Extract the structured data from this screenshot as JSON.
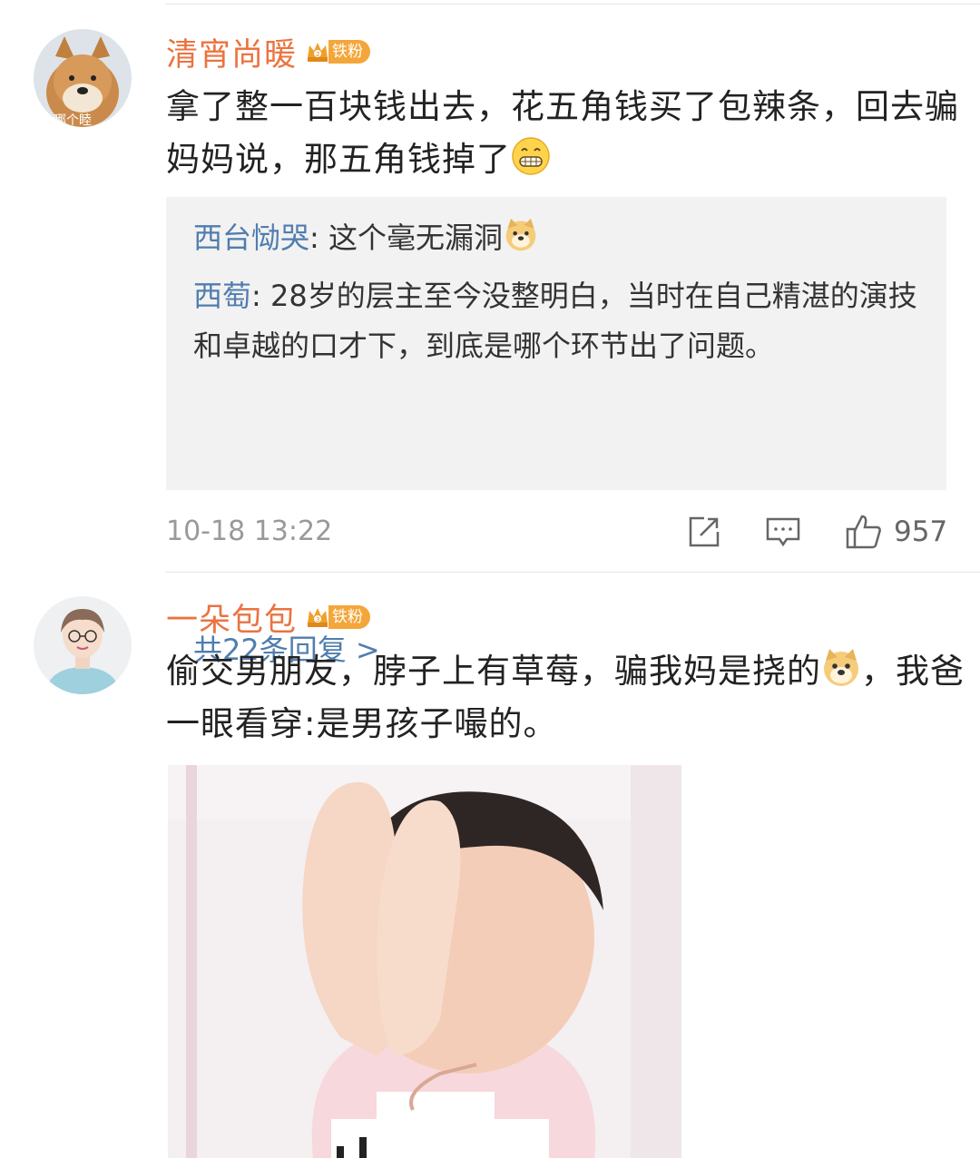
{
  "comments": [
    {
      "username": "清宵尚暖",
      "badge": "铁粉",
      "avatar_caption": "哪个睦",
      "text": "拿了整一百块钱出去，花五角钱买了包辣条，回去骗妈妈说，那五角钱掉了",
      "emoji": "grin-emoji",
      "replies": [
        {
          "name": "西台恸哭",
          "text": ": 这个毫无漏洞"
        },
        {
          "name": "西萄",
          "text": ": 28岁的层主至今没整明白，当时在自己精湛的演技和卓越的口才下，到底是哪个环节出了问题。"
        }
      ],
      "more_replies": "共22条回复 >",
      "timestamp": "10-18 13:22",
      "likes": "957"
    },
    {
      "username": "一朵包包",
      "badge": "铁粉",
      "text_before_emoji": "偷交男朋友，脖子上有草莓，骗我妈是挠的",
      "text_after_emoji": "，我爸一眼看穿:是男孩子嘬的。",
      "emoji": "doge-emoji"
    }
  ],
  "icons": [
    "share-icon",
    "comment-icon",
    "like-icon"
  ],
  "colors": {
    "username": "#eb7340",
    "reply_name": "#507daf",
    "badge": "#f4a63b"
  }
}
